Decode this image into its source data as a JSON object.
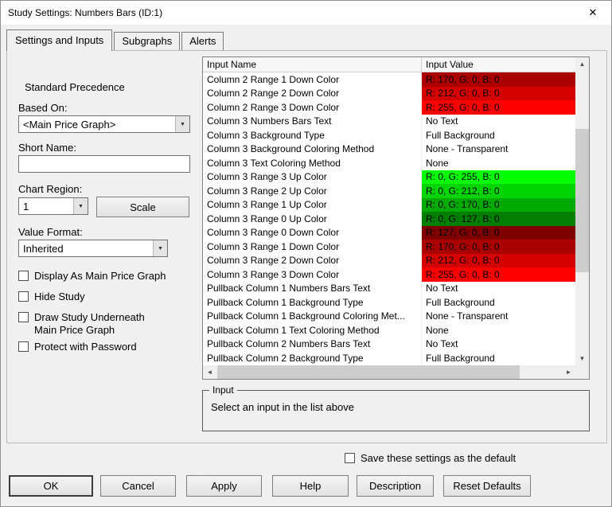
{
  "window": {
    "title": "Study Settings: Numbers Bars (ID:1)"
  },
  "icons": {
    "close": "✕",
    "dropdown": "▼",
    "scroll_up": "▲",
    "scroll_down": "▼",
    "scroll_left": "◄",
    "scroll_right": "►"
  },
  "tabs": [
    {
      "label": "Settings and Inputs",
      "active": true
    },
    {
      "label": "Subgraphs",
      "active": false
    },
    {
      "label": "Alerts",
      "active": false
    }
  ],
  "left_panel": {
    "precedence_label": "Standard Precedence",
    "based_on": {
      "label": "Based On:",
      "value": "<Main Price Graph>"
    },
    "short_name": {
      "label": "Short Name:",
      "value": ""
    },
    "chart_region": {
      "label": "Chart Region:",
      "value": "1"
    },
    "scale_button_label": "Scale",
    "value_format": {
      "label": "Value Format:",
      "value": "Inherited"
    },
    "checkboxes": [
      {
        "label": "Display As Main Price Graph",
        "checked": false
      },
      {
        "label": "Hide Study",
        "checked": false
      },
      {
        "label": "Draw Study Underneath Main Price Graph",
        "checked": false
      },
      {
        "label": "Protect with Password",
        "checked": false
      }
    ]
  },
  "inputs_table": {
    "columns": [
      "Input Name",
      "Input Value"
    ],
    "rows": [
      {
        "name": "Column 2 Range 1 Down Color",
        "value": "R: 170, G: 0, B: 0",
        "bg": "#AA0000",
        "fg": "#000000"
      },
      {
        "name": "Column 2 Range 2 Down Color",
        "value": "R: 212, G: 0, B: 0",
        "bg": "#D40000",
        "fg": "#000000"
      },
      {
        "name": "Column 2 Range 3 Down Color",
        "value": "R: 255, G: 0, B: 0",
        "bg": "#FF0000",
        "fg": "#000000"
      },
      {
        "name": "Column 3 Numbers Bars Text",
        "value": "No Text"
      },
      {
        "name": "Column 3 Background Type",
        "value": "Full Background"
      },
      {
        "name": "Column 3 Background Coloring Method",
        "value": "None - Transparent"
      },
      {
        "name": "Column 3 Text Coloring Method",
        "value": "None"
      },
      {
        "name": "Column 3 Range 3 Up Color",
        "value": "R: 0, G: 255, B: 0",
        "bg": "#00FF00",
        "fg": "#000000"
      },
      {
        "name": "Column 3 Range 2 Up Color",
        "value": "R: 0, G: 212, B: 0",
        "bg": "#00D400",
        "fg": "#000000"
      },
      {
        "name": "Column 3 Range 1 Up Color",
        "value": "R: 0, G: 170, B: 0",
        "bg": "#00AA00",
        "fg": "#000000"
      },
      {
        "name": "Column 3 Range 0 Up Color",
        "value": "R: 0, G: 127, B: 0",
        "bg": "#007F00",
        "fg": "#000000"
      },
      {
        "name": "Column 3 Range 0 Down Color",
        "value": "R: 127, G: 0, B: 0",
        "bg": "#7F0000",
        "fg": "#000000"
      },
      {
        "name": "Column 3 Range 1 Down Color",
        "value": "R: 170, G: 0, B: 0",
        "bg": "#AA0000",
        "fg": "#000000"
      },
      {
        "name": "Column 3 Range 2 Down Color",
        "value": "R: 212, G: 0, B: 0",
        "bg": "#D40000",
        "fg": "#000000"
      },
      {
        "name": "Column 3 Range 3 Down Color",
        "value": "R: 255, G: 0, B: 0",
        "bg": "#FF0000",
        "fg": "#000000"
      },
      {
        "name": "Pullback Column 1 Numbers Bars Text",
        "value": "No Text"
      },
      {
        "name": "Pullback Column 1 Background Type",
        "value": "Full Background"
      },
      {
        "name": "Pullback Column 1 Background Coloring Met...",
        "value": "None - Transparent"
      },
      {
        "name": "Pullback Column 1 Text Coloring Method",
        "value": "None"
      },
      {
        "name": "Pullback Column 2 Numbers Bars Text",
        "value": "No Text"
      },
      {
        "name": "Pullback Column 2 Background Type",
        "value": "Full Background"
      }
    ]
  },
  "input_group": {
    "title": "Input",
    "message": "Select an input in the list above"
  },
  "save_default": {
    "label": "Save these settings as the default",
    "checked": false
  },
  "action_buttons": [
    "OK",
    "Cancel",
    "Apply",
    "Help",
    "Description",
    "Reset Defaults"
  ]
}
